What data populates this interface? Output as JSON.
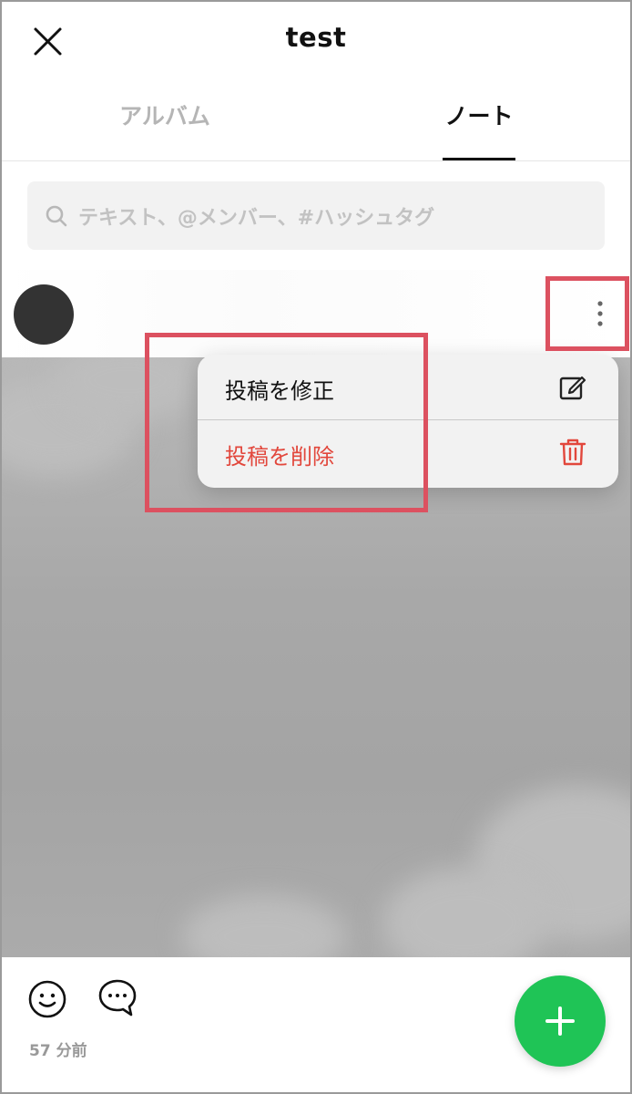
{
  "header": {
    "title": "test",
    "close_icon": "close-icon"
  },
  "tabs": [
    {
      "label": "アルバム",
      "active": false
    },
    {
      "label": "ノート",
      "active": true
    }
  ],
  "search": {
    "placeholder": "テキスト、@メンバー、#ハッシュタグ",
    "icon": "search-icon"
  },
  "post": {
    "more_icon": "more-vertical-icon",
    "menu": {
      "items": [
        {
          "label": "投稿を修正",
          "icon": "edit-icon",
          "color": "#111111"
        },
        {
          "label": "投稿を削除",
          "icon": "trash-icon",
          "color": "#e2473c"
        }
      ]
    },
    "timestamp": "57 分前",
    "reaction_icons": [
      "smile-icon",
      "comment-icon"
    ]
  },
  "fab": {
    "icon": "plus-icon",
    "color": "#1fc456"
  },
  "colors": {
    "annotation": "#dc5160",
    "accent": "#1fc456",
    "danger": "#e2473c"
  }
}
